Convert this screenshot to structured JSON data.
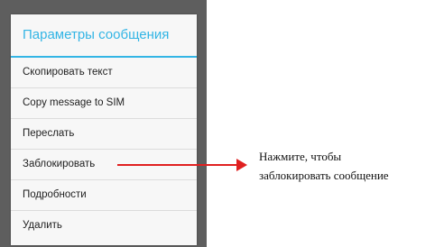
{
  "dialog": {
    "title": "Параметры сообщения",
    "items": [
      {
        "label": "Скопировать текст"
      },
      {
        "label": "Copy message to SIM"
      },
      {
        "label": "Переслать"
      },
      {
        "label": "Заблокировать"
      },
      {
        "label": "Подробности"
      },
      {
        "label": "Удалить"
      }
    ]
  },
  "callout": {
    "line1": "Нажмите, чтобы",
    "line2": "заблокировать сообщение"
  },
  "colors": {
    "accent": "#33b5e5",
    "callout": "#e02020",
    "backdrop": "#5e5e5e"
  }
}
